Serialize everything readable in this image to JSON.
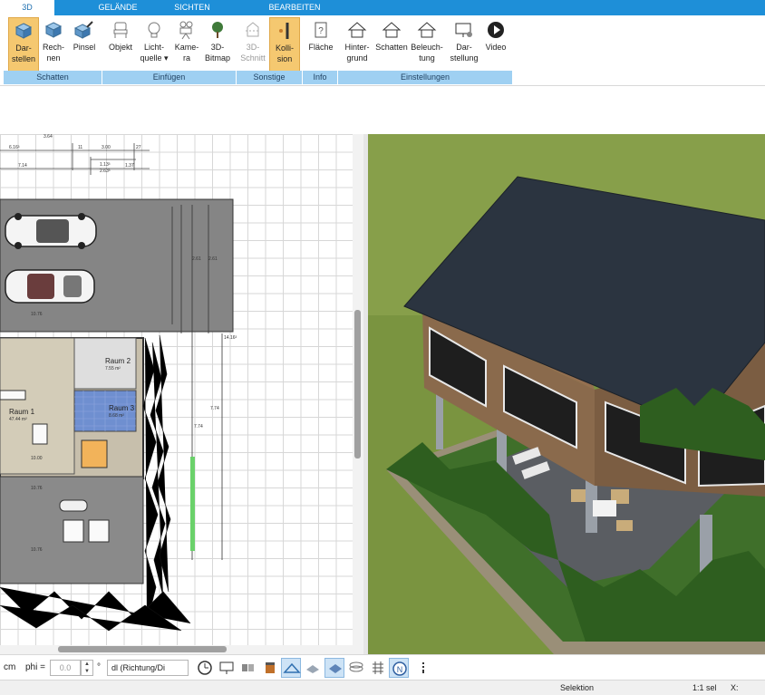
{
  "tabs": [
    {
      "label": "3D",
      "active": true
    },
    {
      "label": "GELÄNDE",
      "active": false
    },
    {
      "label": "SICHTEN",
      "active": false
    },
    {
      "label": "BEARBEITEN",
      "active": false
    }
  ],
  "ribbon": {
    "buttons": [
      {
        "line1": "Dar-",
        "line2": "stellen",
        "icon": "cube-render-icon",
        "active": true
      },
      {
        "line1": "Rech-",
        "line2": "nen",
        "icon": "cube-calc-icon"
      },
      {
        "line1": "Pinsel",
        "line2": "",
        "icon": "cube-brush-icon"
      },
      {
        "line1": "Objekt",
        "line2": "",
        "icon": "chair-icon"
      },
      {
        "line1": "Licht-",
        "line2": "quelle ▾",
        "icon": "lightbulb-icon"
      },
      {
        "line1": "Kame-",
        "line2": "ra",
        "icon": "camera-icon"
      },
      {
        "line1": "3D-",
        "line2": "Bitmap",
        "icon": "tree-icon"
      },
      {
        "line1": "3D-",
        "line2": "Schnitt",
        "icon": "section-icon",
        "disabled": true
      },
      {
        "line1": "Kolli-",
        "line2": "sion",
        "icon": "collision-icon",
        "active": true
      },
      {
        "line1": "Fläche",
        "line2": "",
        "icon": "area-info-icon"
      },
      {
        "line1": "Hinter-",
        "line2": "grund",
        "icon": "house-background-icon"
      },
      {
        "line1": "Schatten",
        "line2": "",
        "icon": "house-shadow-icon"
      },
      {
        "line1": "Beleuch-",
        "line2": "tung",
        "icon": "house-lighting-icon"
      },
      {
        "line1": "Dar-",
        "line2": "stellung",
        "icon": "monitor-settings-icon"
      },
      {
        "line1": "Video",
        "line2": "",
        "icon": "play-icon"
      }
    ],
    "groups": [
      "Schatten",
      "Einfügen",
      "Sonstige",
      "Info",
      "Einstellungen"
    ]
  },
  "plan": {
    "rooms": [
      {
        "name": "Raum 1",
        "area": "47.44 m²"
      },
      {
        "name": "Raum 2",
        "area": "7.55 m²"
      },
      {
        "name": "Raum 3",
        "area": "8.68 m²"
      }
    ],
    "dims": [
      "6.16³",
      "11",
      "3.00",
      "27",
      "7.14",
      "1.13³",
      "1.37",
      "2.63³",
      "10.76",
      "10.00",
      "10.76",
      "10.76",
      "14.16³",
      "7.74",
      "7.74",
      "2.61",
      "2.61",
      "3.64"
    ]
  },
  "bottom": {
    "unit": "cm",
    "phi_label": "phi =",
    "phi_value": "0.0",
    "degree": "°",
    "dropdown": "dl (Richtung/Di",
    "tools": [
      "clock-icon",
      "monitor-icon",
      "walls-icon",
      "paint-bucket-icon",
      "plane-select-icon",
      "hatch-icon",
      "layer-icon",
      "stack-icon",
      "grid-icon",
      "north-icon",
      "more-icon"
    ]
  },
  "status": {
    "mode": "Selektion",
    "scale": "1:1 sel",
    "x_label": "X:"
  },
  "colors": {
    "tabbar": "#1e8fd8",
    "group_label": "#9fd0f2",
    "active_button": "#f5c870",
    "grass": "#79933a",
    "roof": "#2b3440"
  }
}
